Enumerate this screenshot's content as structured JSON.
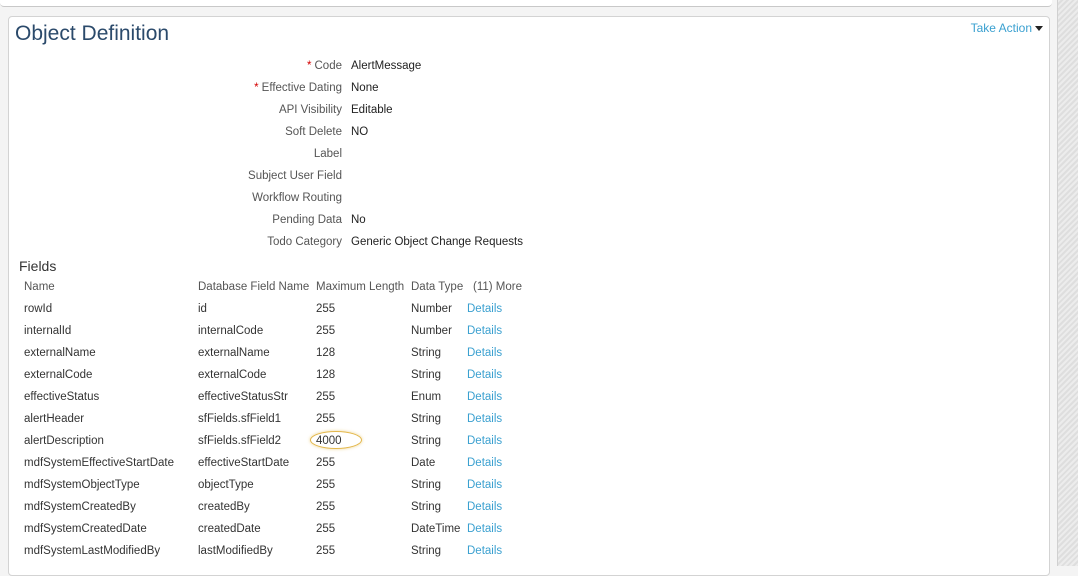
{
  "title": "Object Definition",
  "take_action": "Take Action",
  "properties": [
    {
      "label": "Code",
      "required": "*",
      "value": "AlertMessage"
    },
    {
      "label": "Effective Dating",
      "required": "*",
      "value": "None"
    },
    {
      "label": "API Visibility",
      "required": "",
      "value": "Editable"
    },
    {
      "label": "Soft Delete",
      "required": "",
      "value": "NO"
    },
    {
      "label": "Label",
      "required": "",
      "value": ""
    },
    {
      "label": "Subject User Field",
      "required": "",
      "value": ""
    },
    {
      "label": "Workflow Routing",
      "required": "",
      "value": ""
    },
    {
      "label": "Pending Data",
      "required": "",
      "value": "No"
    },
    {
      "label": "Todo Category",
      "required": "",
      "value": "Generic Object Change Requests"
    }
  ],
  "fields": {
    "title": "Fields",
    "headers": [
      "Name",
      "Database Field Name",
      "Maximum Length",
      "Data Type",
      "(11) More"
    ],
    "rows": [
      {
        "name": "rowId",
        "db": "id",
        "len": "255",
        "type": "Number",
        "link": "Details"
      },
      {
        "name": "internalId",
        "db": "internalCode",
        "len": "255",
        "type": "Number",
        "link": "Details"
      },
      {
        "name": "externalName",
        "db": "externalName",
        "len": "128",
        "type": "String",
        "link": "Details"
      },
      {
        "name": "externalCode",
        "db": "externalCode",
        "len": "128",
        "type": "String",
        "link": "Details"
      },
      {
        "name": "effectiveStatus",
        "db": "effectiveStatusStr",
        "len": "255",
        "type": "Enum",
        "link": "Details"
      },
      {
        "name": "alertHeader",
        "db": "sfFields.sfField1",
        "len": "255",
        "type": "String",
        "link": "Details"
      },
      {
        "name": "alertDescription",
        "db": "sfFields.sfField2",
        "len": "4000",
        "type": "String",
        "link": "Details"
      },
      {
        "name": "mdfSystemEffectiveStartDate",
        "db": "effectiveStartDate",
        "len": "255",
        "type": "Date",
        "link": "Details"
      },
      {
        "name": "mdfSystemObjectType",
        "db": "objectType",
        "len": "255",
        "type": "String",
        "link": "Details"
      },
      {
        "name": "mdfSystemCreatedBy",
        "db": "createdBy",
        "len": "255",
        "type": "String",
        "link": "Details"
      },
      {
        "name": "mdfSystemCreatedDate",
        "db": "createdDate",
        "len": "255",
        "type": "DateTime",
        "link": "Details"
      },
      {
        "name": "mdfSystemLastModifiedBy",
        "db": "lastModifiedBy",
        "len": "255",
        "type": "String",
        "link": "Details"
      }
    ]
  },
  "highlight_row": "alertDescription",
  "colors": {
    "accent": "#3aa0d0",
    "title": "#2b4a6b",
    "required": "#d40000",
    "highlight": "#e3b74a"
  }
}
